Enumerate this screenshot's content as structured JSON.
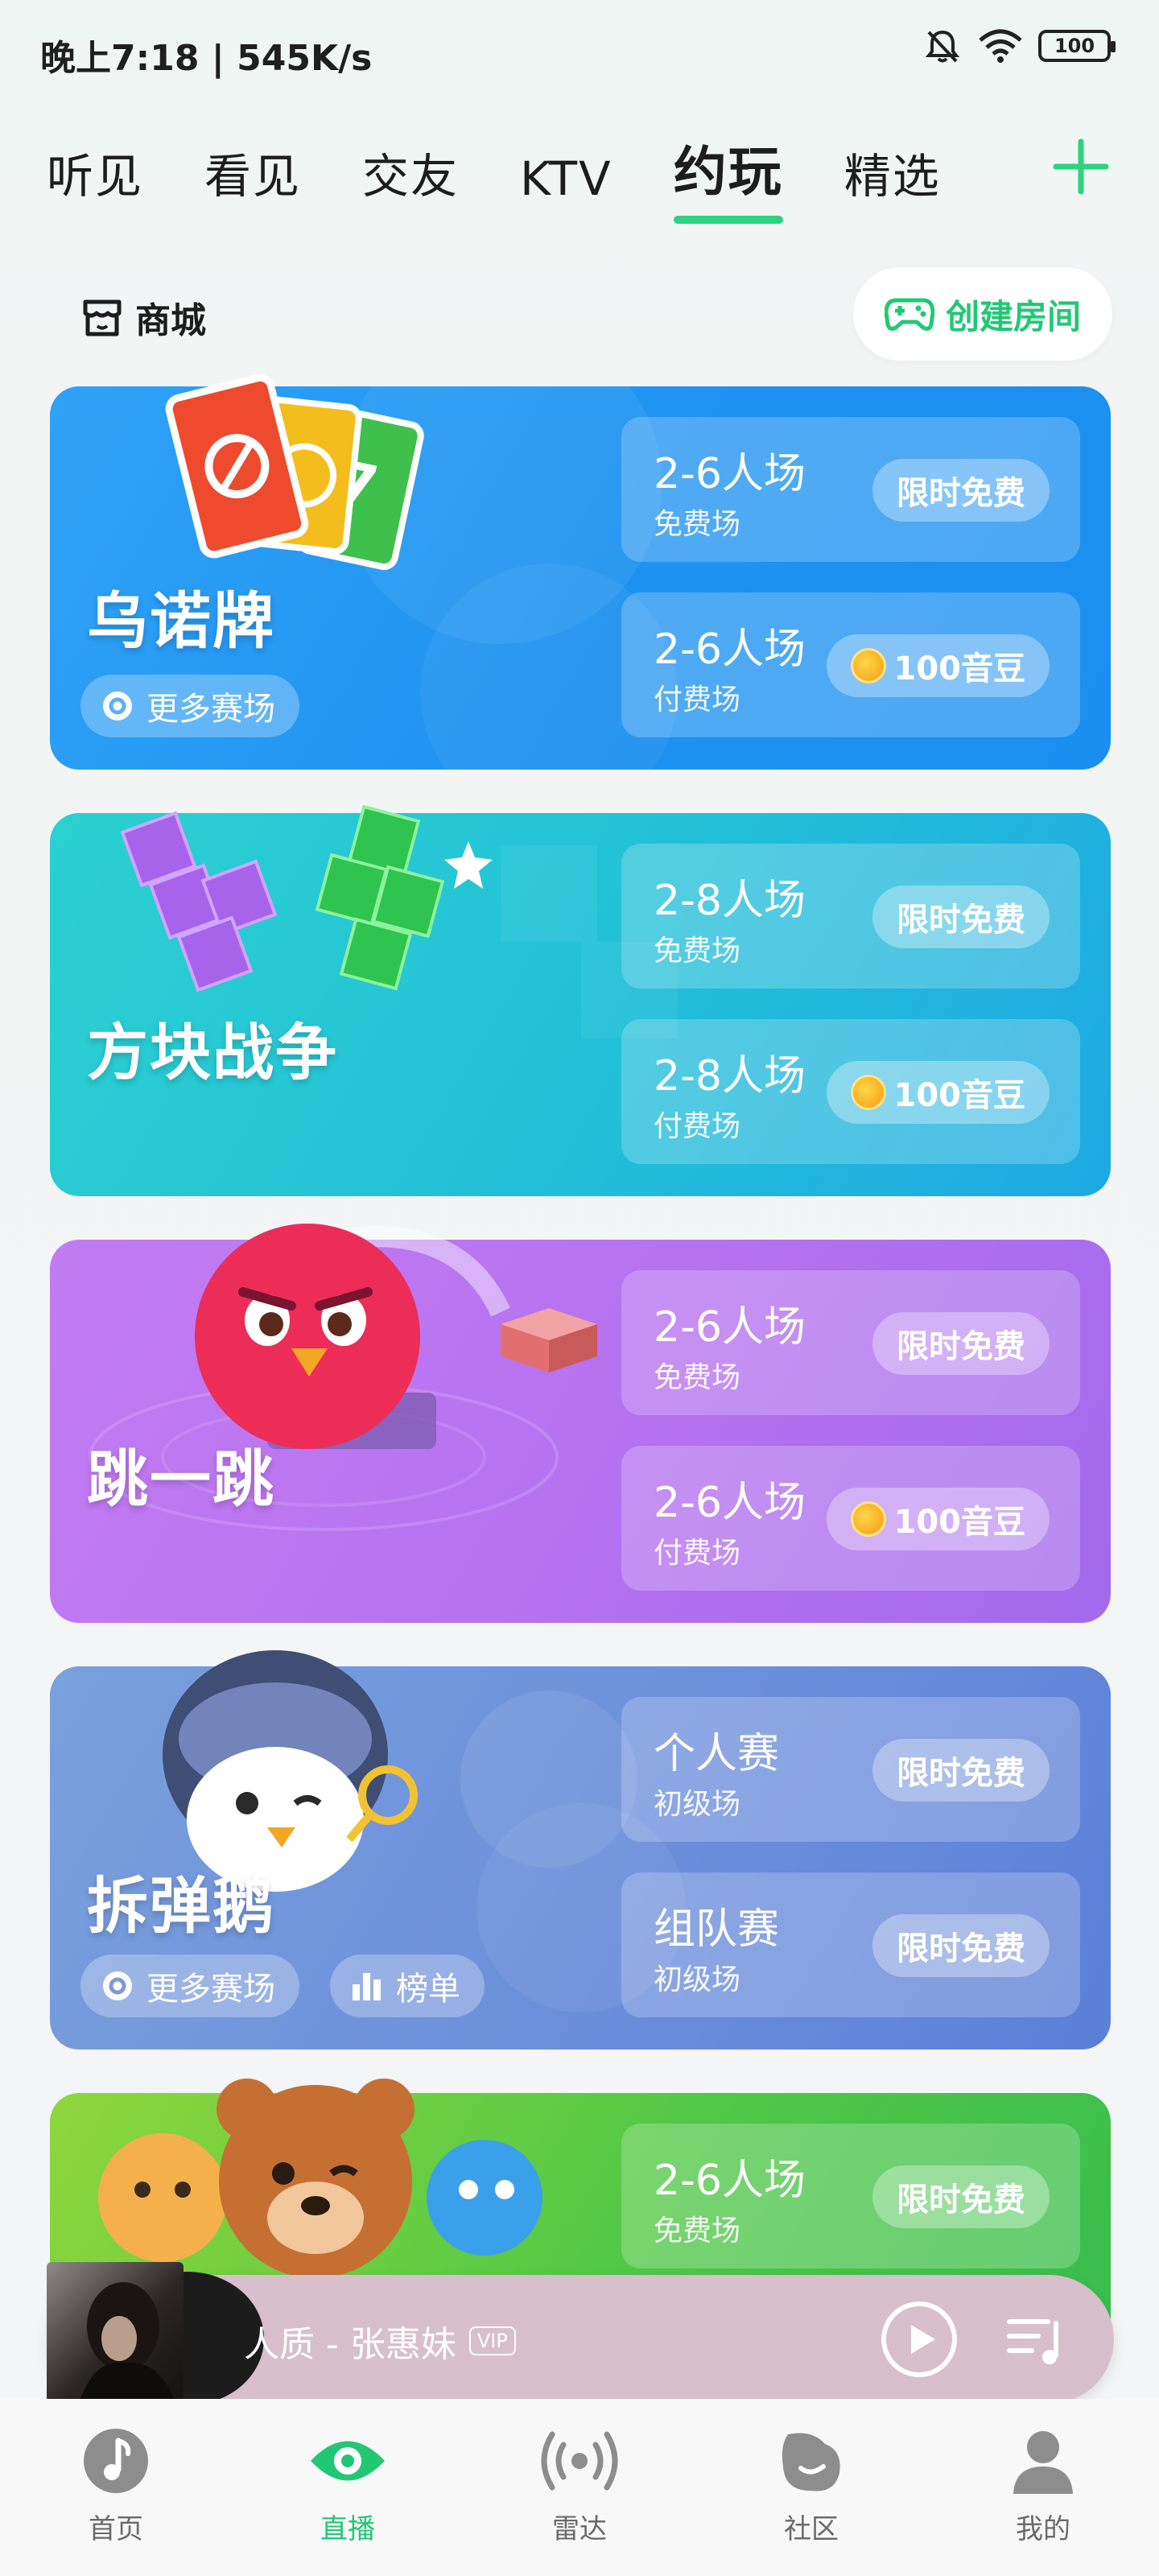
{
  "status_bar": {
    "time": "晚上7:18 | 545K/s",
    "battery": "100"
  },
  "top_tabs": [
    {
      "label": "听见"
    },
    {
      "label": "看见"
    },
    {
      "label": "交友"
    },
    {
      "label": "KTV"
    },
    {
      "label": "约玩",
      "active": true
    },
    {
      "label": "精选"
    }
  ],
  "shop": {
    "label": "商城"
  },
  "create_room": {
    "label": "创建房间"
  },
  "games": [
    {
      "title": "乌诺牌",
      "chips": [
        {
          "label": "更多赛场",
          "icon": "target-icon"
        }
      ],
      "rooms": [
        {
          "name": "2-6人场",
          "sub": "免费场",
          "badge": "限时免费"
        },
        {
          "name": "2-6人场",
          "sub": "付费场",
          "badge": "100音豆",
          "coin": true
        }
      ]
    },
    {
      "title": "方块战争",
      "chips": [],
      "rooms": [
        {
          "name": "2-8人场",
          "sub": "免费场",
          "badge": "限时免费"
        },
        {
          "name": "2-8人场",
          "sub": "付费场",
          "badge": "100音豆",
          "coin": true
        }
      ]
    },
    {
      "title": "跳一跳",
      "chips": [],
      "rooms": [
        {
          "name": "2-6人场",
          "sub": "免费场",
          "badge": "限时免费"
        },
        {
          "name": "2-6人场",
          "sub": "付费场",
          "badge": "100音豆",
          "coin": true
        }
      ]
    },
    {
      "title": "拆弹鹅",
      "chips": [
        {
          "label": "更多赛场",
          "icon": "target-icon"
        },
        {
          "label": "榜单",
          "icon": "bar-chart-icon"
        }
      ],
      "rooms": [
        {
          "name": "个人赛",
          "sub": "初级场",
          "badge": "限时免费"
        },
        {
          "name": "组队赛",
          "sub": "初级场",
          "badge": "限时免费"
        }
      ]
    },
    {
      "title": "",
      "chips": [],
      "rooms": [
        {
          "name": "2-6人场",
          "sub": "免费场",
          "badge": "限时免费"
        }
      ]
    }
  ],
  "player": {
    "song": "人质 - 张惠妹",
    "vip": "VIP"
  },
  "bottom_nav": [
    {
      "label": "首页",
      "icon": "music-note-icon"
    },
    {
      "label": "直播",
      "icon": "eye-icon",
      "active": true
    },
    {
      "label": "雷达",
      "icon": "radar-icon"
    },
    {
      "label": "社区",
      "icon": "community-icon"
    },
    {
      "label": "我的",
      "icon": "profile-icon"
    }
  ],
  "colors": {
    "accent": "#22c774",
    "card_uno": "#1e9bf2",
    "card_block": "#23c6d2",
    "card_jump": "#b676ef",
    "card_goose": "#5b80d6",
    "card_green": "#49c84a"
  }
}
